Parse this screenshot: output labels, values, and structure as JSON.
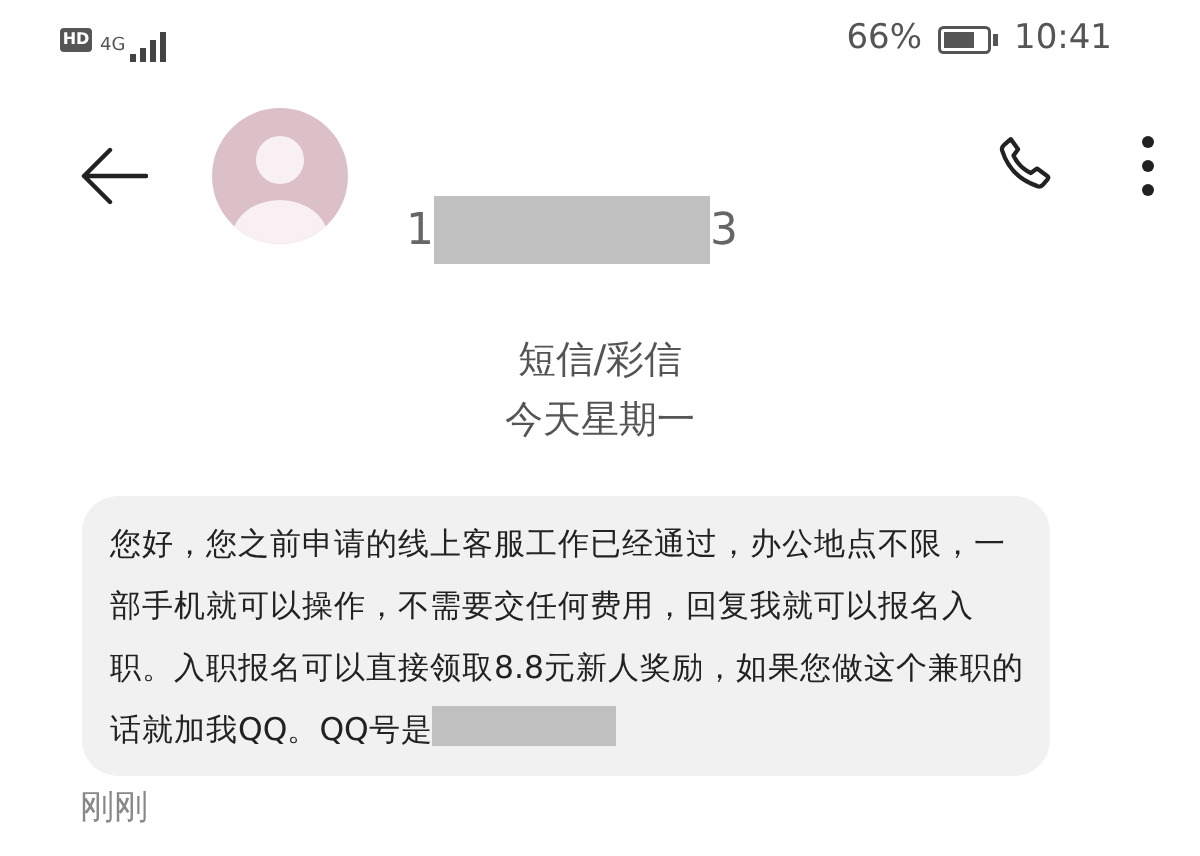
{
  "status_bar": {
    "hd": "HD",
    "network": "4G",
    "battery": "66%",
    "time": "10:41"
  },
  "header": {
    "number_start": "1",
    "number_end": "3",
    "number_redacted": true
  },
  "conversation": {
    "channel": "短信/彩信",
    "day": "今天星期一"
  },
  "messages": [
    {
      "text": "您好，您之前申请的线上客服工作已经通过，办公地点不限，一部手机就可以操作，不需要交任何费用，回复我就可以报名入职。入职报名可以直接领取8.8元新人奖励，如果您做这个兼职的话就加我QQ。QQ号是",
      "redacted_tail": true,
      "time": "刚刚"
    }
  ]
}
